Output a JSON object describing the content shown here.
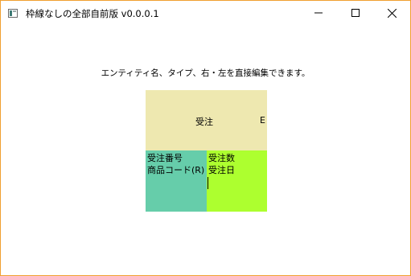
{
  "window": {
    "title": "枠線なしの全部自前版 v0.0.0.1",
    "minimize_icon": "minimize-icon",
    "maximize_icon": "maximize-icon",
    "close_icon": "close-icon",
    "border_color": "#f0a030"
  },
  "main": {
    "hint": "エンティティ名、タイプ、右・左を直接編集できます。"
  },
  "entity": {
    "name": "受注",
    "type": "E",
    "header_color": "#eee8b0",
    "left": {
      "color": "#66cdaa",
      "fields": [
        "受注番号",
        "商品コード(R)"
      ]
    },
    "right": {
      "color": "#adff2f",
      "fields": [
        "受注数",
        "受注日"
      ]
    }
  }
}
